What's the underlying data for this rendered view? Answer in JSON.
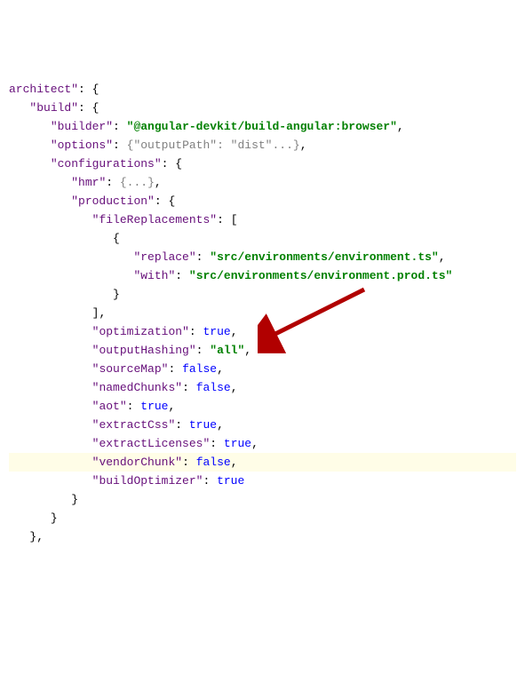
{
  "keys": {
    "architect": "architect",
    "build": "build",
    "builder": "builder",
    "options": "options",
    "configurations": "configurations",
    "hmr": "hmr",
    "production": "production",
    "fileReplacements": "fileReplacements",
    "replace": "replace",
    "with": "with",
    "optimization": "optimization",
    "outputHashing": "outputHashing",
    "sourceMap": "sourceMap",
    "namedChunks": "namedChunks",
    "aot": "aot",
    "extractCss": "extractCss",
    "extractLicenses": "extractLicenses",
    "vendorChunk": "vendorChunk",
    "buildOptimizer": "buildOptimizer"
  },
  "vals": {
    "builder": "\"@angular-devkit/build-angular:browser\"",
    "optionsCollapsed": "{\"outputPath\": \"dist\"...}",
    "hmrCollapsed": "{...}",
    "replace": "\"src/environments/environment.ts\"",
    "with": "\"src/environments/environment.prod.ts\"",
    "true": "true",
    "false": "false",
    "all": "\"all\""
  },
  "punct": {
    "q": "\"",
    "colon": ": ",
    "comma": ",",
    "lbrace": "{",
    "rbrace": "}",
    "lbracket": "[",
    "rbracket": "]"
  }
}
